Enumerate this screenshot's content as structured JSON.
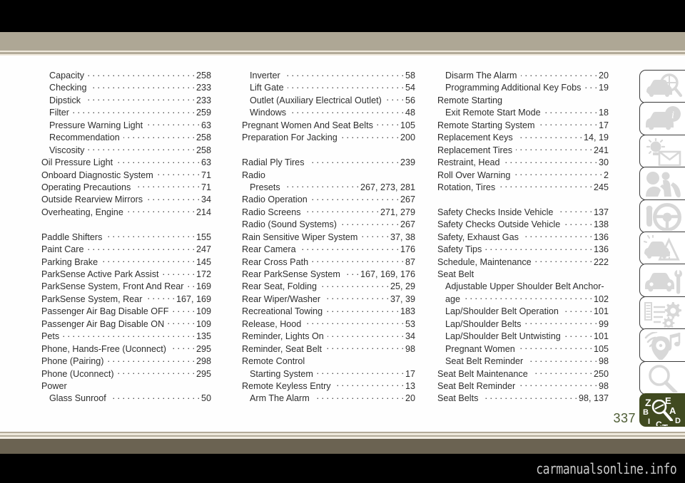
{
  "document": {
    "page_number": "337",
    "watermark": "carmanualsonline.info",
    "accent_green": "#404a20",
    "folio_color": "#4d5c34",
    "band_tan": "#aea795",
    "band_brown": "#6b6352"
  },
  "columns": [
    {
      "id": "column-1",
      "entries": [
        {
          "title": "Capacity",
          "page": "258",
          "level": 2
        },
        {
          "title": "Checking",
          "page": "233",
          "level": 2
        },
        {
          "title": "Dipstick",
          "page": "233",
          "level": 2
        },
        {
          "title": "Filter",
          "page": "259",
          "level": 2
        },
        {
          "title": "Pressure Warning Light",
          "page": "63",
          "level": 2
        },
        {
          "title": "Recommendation",
          "page": "258",
          "level": 2
        },
        {
          "title": "Viscosity",
          "page": "258",
          "level": 2
        },
        {
          "title": "Oil Pressure Light",
          "page": "63",
          "level": 1
        },
        {
          "title": "Onboard Diagnostic System",
          "page": "71",
          "level": 1
        },
        {
          "title": "Operating Precautions",
          "page": "71",
          "level": 1
        },
        {
          "title": "Outside Rearview Mirrors",
          "page": "34",
          "level": 1
        },
        {
          "title": "Overheating, Engine",
          "page": "214",
          "level": 1
        },
        {
          "title": "",
          "page": "",
          "level": 1,
          "spacer": true
        },
        {
          "title": "Paddle Shifters",
          "page": "155",
          "level": 1
        },
        {
          "title": "Paint Care",
          "page": "247",
          "level": 1
        },
        {
          "title": "Parking Brake",
          "page": "145",
          "level": 1
        },
        {
          "title": "ParkSense Active Park Assist",
          "page": "172",
          "level": 1
        },
        {
          "title": "ParkSense System, Front And Rear",
          "page": "169",
          "level": 1
        },
        {
          "title": "ParkSense System, Rear",
          "page": "167, 169",
          "level": 1
        },
        {
          "title": "Passenger Air Bag Disable OFF",
          "page": "109",
          "level": 1
        },
        {
          "title": "Passenger Air Bag Disable ON",
          "page": "109",
          "level": 1
        },
        {
          "title": "Pets",
          "page": "135",
          "level": 1
        },
        {
          "title": "Phone, Hands-Free (Uconnect)",
          "page": "295",
          "level": 1
        },
        {
          "title": "Phone (Pairing)",
          "page": "298",
          "level": 1
        },
        {
          "title": "Phone (Uconnect)",
          "page": "295",
          "level": 1
        },
        {
          "title": "Power",
          "page": "",
          "level": 1,
          "nodots": true
        },
        {
          "title": "Glass Sunroof",
          "page": "50",
          "level": 2
        }
      ]
    },
    {
      "id": "column-2",
      "entries": [
        {
          "title": "Inverter",
          "page": "58",
          "level": 2
        },
        {
          "title": "Lift Gate",
          "page": "54",
          "level": 2
        },
        {
          "title": "Outlet (Auxiliary Electrical Outlet)",
          "page": "56",
          "level": 2
        },
        {
          "title": "Windows",
          "page": "48",
          "level": 2
        },
        {
          "title": "Pregnant Women And Seat Belts",
          "page": "105",
          "level": 1
        },
        {
          "title": "Preparation For Jacking",
          "page": "200",
          "level": 1
        },
        {
          "title": "",
          "page": "",
          "level": 1,
          "spacer": true
        },
        {
          "title": "Radial Ply Tires",
          "page": "239",
          "level": 1
        },
        {
          "title": "Radio",
          "page": "",
          "level": 1,
          "nodots": true
        },
        {
          "title": "Presets",
          "page": "267, 273, 281",
          "level": 2
        },
        {
          "title": "Radio Operation",
          "page": "267",
          "level": 1
        },
        {
          "title": "Radio Screens",
          "page": "271, 279",
          "level": 1
        },
        {
          "title": "Radio (Sound Systems)",
          "page": "267",
          "level": 1
        },
        {
          "title": "Rain Sensitive Wiper System",
          "page": "37, 38",
          "level": 1
        },
        {
          "title": "Rear Camera",
          "page": "176",
          "level": 1
        },
        {
          "title": "Rear Cross Path",
          "page": "87",
          "level": 1
        },
        {
          "title": "Rear ParkSense System",
          "page": "167, 169, 176",
          "level": 1
        },
        {
          "title": "Rear Seat, Folding",
          "page": "25, 29",
          "level": 1
        },
        {
          "title": "Rear Wiper/Washer",
          "page": "37, 39",
          "level": 1
        },
        {
          "title": "Recreational Towing",
          "page": "183",
          "level": 1
        },
        {
          "title": "Release, Hood",
          "page": "53",
          "level": 1
        },
        {
          "title": "Reminder, Lights On",
          "page": "34",
          "level": 1
        },
        {
          "title": "Reminder, Seat Belt",
          "page": "98",
          "level": 1
        },
        {
          "title": "Remote Control",
          "page": "",
          "level": 1,
          "nodots": true
        },
        {
          "title": "Starting System",
          "page": "17",
          "level": 2
        },
        {
          "title": "Remote Keyless Entry",
          "page": "13",
          "level": 1
        },
        {
          "title": "Arm The Alarm",
          "page": "20",
          "level": 2
        }
      ]
    },
    {
      "id": "column-3",
      "entries": [
        {
          "title": "Disarm The Alarm",
          "page": "20",
          "level": 2
        },
        {
          "title": "Programming Additional Key Fobs",
          "page": "19",
          "level": 2
        },
        {
          "title": "Remote Starting",
          "page": "",
          "level": 1,
          "nodots": true
        },
        {
          "title": "Exit Remote Start Mode",
          "page": "18",
          "level": 2
        },
        {
          "title": "Remote Starting System",
          "page": "17",
          "level": 1
        },
        {
          "title": "Replacement Keys",
          "page": "14, 19",
          "level": 1
        },
        {
          "title": "Replacement Tires",
          "page": "241",
          "level": 1
        },
        {
          "title": "Restraint, Head",
          "page": "30",
          "level": 1
        },
        {
          "title": "Roll Over Warning",
          "page": "2",
          "level": 1
        },
        {
          "title": "Rotation, Tires",
          "page": "245",
          "level": 1
        },
        {
          "title": "",
          "page": "",
          "level": 1,
          "spacer": true
        },
        {
          "title": "Safety Checks Inside Vehicle",
          "page": "137",
          "level": 1
        },
        {
          "title": "Safety Checks Outside Vehicle",
          "page": "138",
          "level": 1
        },
        {
          "title": "Safety, Exhaust Gas",
          "page": "136",
          "level": 1
        },
        {
          "title": "Safety Tips",
          "page": "136",
          "level": 1
        },
        {
          "title": "Schedule, Maintenance",
          "page": "222",
          "level": 1
        },
        {
          "title": "Seat Belt",
          "page": "",
          "level": 1,
          "nodots": true
        },
        {
          "title": "Adjustable Upper Shoulder Belt Anchor-",
          "page": "",
          "level": 2,
          "nodots": true
        },
        {
          "title": "age",
          "page": "102",
          "level": 2
        },
        {
          "title": "Lap/Shoulder Belt Operation",
          "page": "101",
          "level": 2
        },
        {
          "title": "Lap/Shoulder Belts",
          "page": "99",
          "level": 2
        },
        {
          "title": "Lap/Shoulder Belt Untwisting",
          "page": "101",
          "level": 2
        },
        {
          "title": "Pregnant Women",
          "page": "105",
          "level": 2
        },
        {
          "title": "Seat Belt Reminder",
          "page": "98",
          "level": 2
        },
        {
          "title": "Seat Belt Maintenance",
          "page": "250",
          "level": 1
        },
        {
          "title": "Seat Belt Reminder",
          "page": "98",
          "level": 1
        },
        {
          "title": "Seat Belts",
          "page": "98, 137",
          "level": 1
        }
      ]
    }
  ],
  "tabs": [
    {
      "icon": "car-magnifier-icon",
      "label": "Getting To Know Your Vehicle"
    },
    {
      "icon": "car-info-icon",
      "label": "Getting To Know Your Instrument Panel"
    },
    {
      "icon": "lamp-envelope-icon",
      "label": "Understanding Your Instrument Panel"
    },
    {
      "icon": "airbag-occupant-icon",
      "label": "Safety"
    },
    {
      "icon": "key-steering-wheel-icon",
      "label": "Starting And Operating"
    },
    {
      "icon": "car-warning-triangle-icon",
      "label": "What To Do In Emergencies"
    },
    {
      "icon": "car-wrench-icon",
      "label": "Servicing And Maintenance"
    },
    {
      "icon": "list-gears-icon",
      "label": "Technical Specifications"
    },
    {
      "icon": "media-note-icon",
      "label": "Multimedia"
    },
    {
      "icon": "magnifier-icon",
      "label": "Search"
    },
    {
      "icon": "index-letters-icon",
      "label": "Index",
      "letters": [
        "Z",
        "E",
        "B",
        "A",
        "I",
        "C",
        "T",
        "D"
      ],
      "active": true
    }
  ]
}
